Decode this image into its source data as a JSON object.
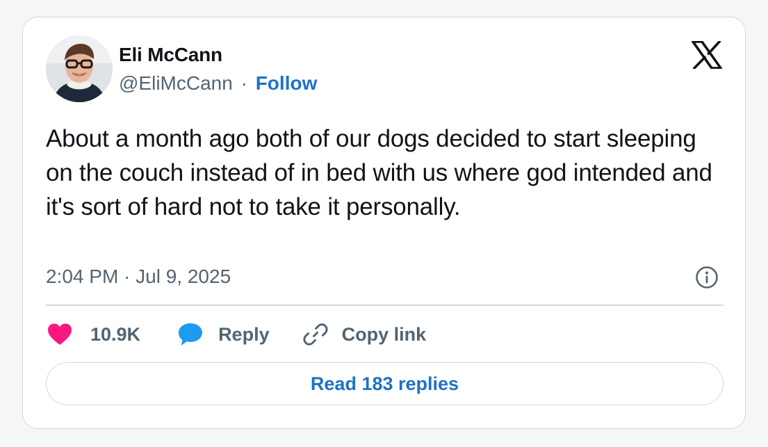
{
  "author": {
    "name": "Eli McCann",
    "handle": "@EliMcCann",
    "separator": "·",
    "follow_label": "Follow"
  },
  "brand": {
    "logo_icon": "x-logo-icon"
  },
  "tweet": {
    "text": "About a month ago both of our dogs decided to start sleeping on the couch instead of in bed with us where god intended and it's sort of hard not to take it personally.",
    "timestamp": "2:04 PM · Jul 9, 2025"
  },
  "actions": {
    "like_count": "10.9K",
    "reply_label": "Reply",
    "copy_label": "Copy link"
  },
  "footer": {
    "read_replies_label": "Read 183 replies"
  },
  "colors": {
    "accent": "#1d72c7",
    "like": "#f91880",
    "reply": "#1d9bf0",
    "text": "#0f1419",
    "muted": "#536471",
    "border": "#cfd9de"
  }
}
